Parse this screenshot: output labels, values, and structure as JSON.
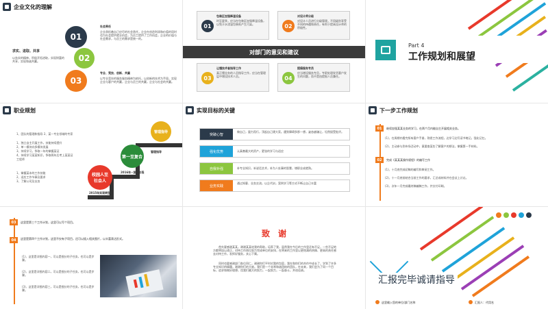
{
  "slide1": {
    "title": "企业文化的理解",
    "left_heading": "求实、进取、共享",
    "left_text": "以务实的精神，积极开拓进取，实现财富的共享，实现和谐共赢。",
    "circles": [
      {
        "num": "01",
        "color": "#2b3a4a",
        "heading": "社会责任",
        "text": "企业承担着自己应尽的社会责任，企业在创造利润和价值的同时也为社会提供就业机会，为员工提供了工作机会，企业的价值与社会需求，与员工的需求是统一的。"
      },
      {
        "num": "02",
        "color": "#8cc63f",
        "heading": "",
        "text": ""
      },
      {
        "num": "03",
        "color": "#f07b1d",
        "heading": "专业、竞技、创新、共赢",
        "text": "以专业竞技的服务服务精神为依托，以创新的技术为手段，实现企业与客户的共赢，企业与员工的共赢，企业与社会的共赢。"
      }
    ]
  },
  "slide2": {
    "band_title": "对部门的意见和建议",
    "items": [
      {
        "num": "01",
        "color": "#2b3a4a",
        "heading": "包装区加强降温设备",
        "text": "时至夏季，应当在包装区加强降温设备，以免汗水浸湿包装纸产生污染。"
      },
      {
        "num": "02",
        "color": "#f07b1d",
        "heading": "对设计师分级",
        "text": "对设计人员进行分级管理，不同级别享受不同的待遇和责任，有利于提高设计师的积极性。"
      },
      {
        "num": "03",
        "color": "#e8b11c",
        "heading": "让懂技术者指导工作",
        "text": "真正懂业务的人员指导工作，应当在管理层中增设技术人员。"
      },
      {
        "num": "04",
        "color": "#8cc63f",
        "heading": "提倡服务专员",
        "text": "应当增设服务专员，专职处理发货客户发生的问题，而不是由提报人员兼任。"
      }
    ]
  },
  "slide3": {
    "part_label": "Part 4",
    "title": "工作规划和展望"
  },
  "slide4": {
    "title": "职业规划",
    "list_items": [
      "1、团队的管理和指导  2、某一专业领域的专家",
      "1、独立自主开展工作，技能持续提升",
      "2、单一模块向多模块发展",
      "3、持续学习，争取一年的掌握某证",
      "4、持续学习某某知识，争取两年后考上某某证",
      "工程师",
      "1、掌握某本的工作技能",
      "2、适应工作节奏及要求",
      "3、了解公司及业务"
    ],
    "stages": [
      {
        "label": "管理指导",
        "color": "#e8b11c"
      },
      {
        "label": "第一至复合",
        "color": "#2b8c3a"
      },
      {
        "label": "校园人至社会人",
        "color": "#e8392b"
      }
    ],
    "year_labels": [
      "2016年~复合阶段",
      "2015年实现转型"
    ],
    "mgr_text": "管理指导"
  },
  "slide5": {
    "title": "实现目标的关键",
    "rows": [
      {
        "label": "突破心智",
        "color": "#2b3a4a",
        "text": "做自己，量力而行，顶起自己建大家。遇到障碍多那一想，姿态越谦让，坦然接受批评。"
      },
      {
        "label": "强化优势",
        "color": "#1fa3d9",
        "text": "认真善最大的资产，更张的学习与适应"
      },
      {
        "label": "自我补强",
        "color": "#8cc63f",
        "text": "补专业知识，补说话艺术，补为人处事的智慧，增职业成就熟。"
      },
      {
        "label": "业务实践",
        "color": "#f07b1d",
        "text": "通过知客、业务交流，以企代训，案例学习等方式不断让自己丰富"
      }
    ]
  },
  "slide6": {
    "title": "下一步工作规划",
    "items": [
      {
        "num": "01",
        "heading": "继续加强某某业务的学习，在两个月内能自主开展相关业务。",
        "subs": [
          "(1)、在周期内看完所有客户手册，熟悉工作流程，边学习边写读书笔记，强化记忆。",
          "(2)、主动参与到市场活动中，意要查某些了解客户的想法，掌握第一手材料。"
        ]
      },
      {
        "num": "02",
        "heading": "完成《某某某操作规程》的编写工作",
        "subs": [
          "(1)、十月底完成初稿的编写和审阅工作。",
          "(2)、十一月底前结合当前工作的要求，汇总成材料并在会议上讨论。",
          "(3)、次年一月完成最终稿编稿工作，并交付印刷。"
        ]
      }
    ]
  },
  "slide7": {
    "items": [
      {
        "num": "03",
        "text": "这里是第三个工作计划，这里可以写个项目。"
      },
      {
        "num": "04",
        "text": "这里是第四个工作计划，这里不仅有子项目，还可以插入相关图片，以丰富表达形式。"
      }
    ],
    "subs": [
      "(1)、这里是详细内容一，可以是细分的子任务，也可以是步骤。",
      "(2)、这里是详细内容二，可以是细分的子任务，也可以是步骤。",
      "(3)、这里是详细内容三，可以是细分的子任务，也可以是步骤。"
    ]
  },
  "slide8": {
    "title": "致　谢",
    "para1": "首先要感谢某某，谢谢某某给我的帮助，培养了我，虽然我在今后的工作里还有不足，一些不足地方都将加以改正，对待工作岗位努力完成单位的安排，在将来的工作里以更饱满的热情、更高的责任感去对待工作，发挥好服务，关心下属。",
    "para2": "同时也要感谢部门各位同仁，谢谢你们平时对我的包容，我在和你们的合作中成长了，学到了许多专业知识的精髓，谢谢你们的大度。我们是一个非常和谐团结的团队，在未来，我们会为了同一个目标，追求和做好理想，用我们最大的努力，一起努力，一起奋斗，并创佳绩。"
  },
  "slide9": {
    "title": "汇报完毕诚请指导",
    "footer_left": "这里输入您的单位/部门名称",
    "footer_right": "汇报人：代用名"
  }
}
